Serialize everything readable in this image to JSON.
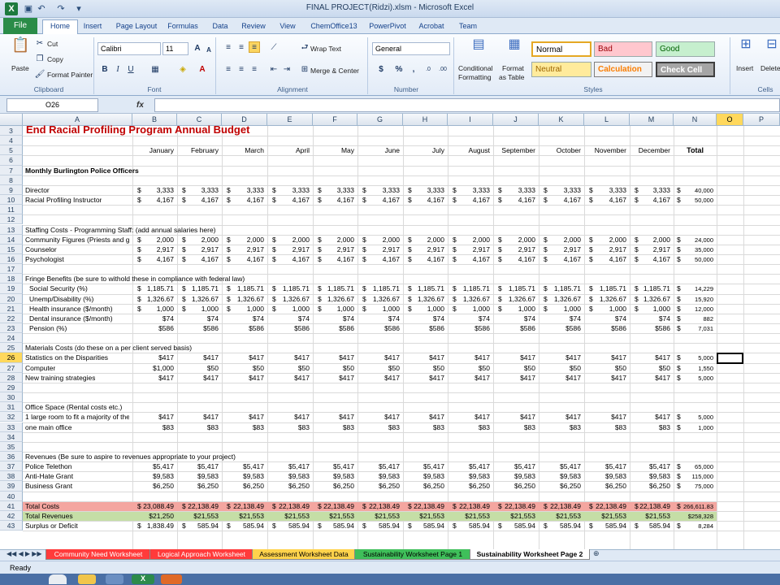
{
  "window": {
    "title": "FINAL PROJECT(Ridzi).xlsm  -  Microsoft Excel"
  },
  "ribbon": {
    "tabs": [
      "File",
      "Home",
      "Insert",
      "Page Layout",
      "Formulas",
      "Data",
      "Review",
      "View",
      "ChemOffice13",
      "PowerPivot",
      "Acrobat",
      "Team"
    ],
    "clipboard": {
      "paste": "Paste",
      "cut": "Cut",
      "copy": "Copy",
      "format_painter": "Format Painter",
      "label": "Clipboard"
    },
    "font": {
      "name": "Calibri",
      "size": "11",
      "label": "Font"
    },
    "alignment": {
      "wrap": "Wrap Text",
      "merge": "Merge & Center",
      "label": "Alignment"
    },
    "number": {
      "format": "General",
      "label": "Number"
    },
    "styles": {
      "cond": "Conditional",
      "cond2": "Formatting",
      "fmt": "Format",
      "fmt2": "as Table",
      "normal": "Normal",
      "bad": "Bad",
      "good": "Good",
      "neutral": "Neutral",
      "calculation": "Calculation",
      "check": "Check Cell",
      "label": "Styles"
    },
    "cells": {
      "insert": "Insert",
      "delete": "Delete",
      "label": "Cells"
    }
  },
  "formula_bar": {
    "name_box": "O26",
    "fx": "fx"
  },
  "grid": {
    "columns": [
      "A",
      "B",
      "C",
      "D",
      "E",
      "F",
      "G",
      "H",
      "I",
      "J",
      "K",
      "L",
      "M",
      "N",
      "O",
      "P"
    ],
    "month_headers": [
      "January",
      "February",
      "March",
      "April",
      "May",
      "June",
      "July",
      "August",
      "September",
      "October",
      "November",
      "December",
      "Total"
    ],
    "title": "End Racial Profiling Program Annual Budget",
    "rows": [
      {
        "n": "3",
        "label": "End Racial Profiling Program Annual Budget",
        "type": "title"
      },
      {
        "n": "4"
      },
      {
        "n": "5",
        "type": "months"
      },
      {
        "n": "6"
      },
      {
        "n": "7",
        "label": "Monthly Burlington Police Officers",
        "type": "bold"
      },
      {
        "n": "8"
      },
      {
        "n": "9",
        "label": "Director",
        "vals": [
          "3,333",
          "3,333",
          "3,333",
          "3,333",
          "3,333",
          "3,333",
          "3,333",
          "3,333",
          "3,333",
          "3,333",
          "3,333",
          "3,333"
        ],
        "total": "40,000",
        "dollar": true
      },
      {
        "n": "10",
        "label": "Racial Profiling Instructor",
        "vals": [
          "4,167",
          "4,167",
          "4,167",
          "4,167",
          "4,167",
          "4,167",
          "4,167",
          "4,167",
          "4,167",
          "4,167",
          "4,167",
          "4,167"
        ],
        "total": "50,000",
        "dollar": true
      },
      {
        "n": "11"
      },
      {
        "n": "12"
      },
      {
        "n": "13",
        "label": "Staffing Costs - Programming Staff: (add annual salaries here)"
      },
      {
        "n": "14",
        "label": "Community Figures (Priests and group lea",
        "vals": [
          "2,000",
          "2,000",
          "2,000",
          "2,000",
          "2,000",
          "2,000",
          "2,000",
          "2,000",
          "2,000",
          "2,000",
          "2,000",
          "2,000"
        ],
        "total": "24,000",
        "dollar": true
      },
      {
        "n": "15",
        "label": "Counselor",
        "vals": [
          "2,917",
          "2,917",
          "2,917",
          "2,917",
          "2,917",
          "2,917",
          "2,917",
          "2,917",
          "2,917",
          "2,917",
          "2,917",
          "2,917"
        ],
        "total": "35,000",
        "dollar": true
      },
      {
        "n": "16",
        "label": "Psychologist",
        "vals": [
          "4,167",
          "4,167",
          "4,167",
          "4,167",
          "4,167",
          "4,167",
          "4,167",
          "4,167",
          "4,167",
          "4,167",
          "4,167",
          "4,167"
        ],
        "total": "50,000",
        "dollar": true
      },
      {
        "n": "17"
      },
      {
        "n": "18",
        "label": "Fringe Benefits (be sure to withold these in compliance with federal law)"
      },
      {
        "n": "19",
        "label": "Social Security (%)",
        "vals": [
          "1,185.71",
          "1,185.71",
          "1,185.71",
          "1,185.71",
          "1,185.71",
          "1,185.71",
          "1,185.71",
          "1,185.71",
          "1,185.71",
          "1,185.71",
          "1,185.71",
          "1,185.71"
        ],
        "total": "14,229",
        "dollar": true,
        "indent": true
      },
      {
        "n": "20",
        "label": "Unemp/Disability (%)",
        "vals": [
          "1,326.67",
          "1,326.67",
          "1,326.67",
          "1,326.67",
          "1,326.67",
          "1,326.67",
          "1,326.67",
          "1,326.67",
          "1,326.67",
          "1,326.67",
          "1,326.67",
          "1,326.67"
        ],
        "total": "15,920",
        "dollar": true,
        "indent": true
      },
      {
        "n": "21",
        "label": "Health insurance ($/month)",
        "vals": [
          "1,000",
          "1,000",
          "1,000",
          "1,000",
          "1,000",
          "1,000",
          "1,000",
          "1,000",
          "1,000",
          "1,000",
          "1,000",
          "1,000"
        ],
        "total": "12,000",
        "dollar": true,
        "indent": true
      },
      {
        "n": "22",
        "label": "Dental insurance ($/month)",
        "vals": [
          "$74",
          "$74",
          "$74",
          "$74",
          "$74",
          "$74",
          "$74",
          "$74",
          "$74",
          "$74",
          "$74",
          "$74"
        ],
        "total": "882",
        "indent": true,
        "tdollar": true
      },
      {
        "n": "23",
        "label": "Pension (%)",
        "vals": [
          "$586",
          "$586",
          "$586",
          "$586",
          "$586",
          "$586",
          "$586",
          "$586",
          "$586",
          "$586",
          "$586",
          "$586"
        ],
        "total": "7,031",
        "indent": true,
        "tdollar": true
      },
      {
        "n": "24"
      },
      {
        "n": "25",
        "label": "Materials Costs (do these on a per client served basis)"
      },
      {
        "n": "26",
        "label": "Statistics on the Disparities",
        "vals": [
          "$417",
          "$417",
          "$417",
          "$417",
          "$417",
          "$417",
          "$417",
          "$417",
          "$417",
          "$417",
          "$417",
          "$417"
        ],
        "total": "5,000",
        "tdollar": true
      },
      {
        "n": "27",
        "label": "Computer",
        "vals": [
          "$1,000",
          "$50",
          "$50",
          "$50",
          "$50",
          "$50",
          "$50",
          "$50",
          "$50",
          "$50",
          "$50",
          "$50"
        ],
        "total": "1,550",
        "tdollar": true
      },
      {
        "n": "28",
        "label": "New training strategies",
        "vals": [
          "$417",
          "$417",
          "$417",
          "$417",
          "$417",
          "$417",
          "$417",
          "$417",
          "$417",
          "$417",
          "$417",
          "$417"
        ],
        "total": "5,000",
        "tdollar": true
      },
      {
        "n": "29"
      },
      {
        "n": "30"
      },
      {
        "n": "31",
        "label": "Office Space (Rental costs etc.)"
      },
      {
        "n": "32",
        "label": "1 large room to fit a majority of the Police fo",
        "vals": [
          "$417",
          "$417",
          "$417",
          "$417",
          "$417",
          "$417",
          "$417",
          "$417",
          "$417",
          "$417",
          "$417",
          "$417"
        ],
        "total": "5,000",
        "tdollar": true
      },
      {
        "n": "33",
        "label": "one main office",
        "vals": [
          "$83",
          "$83",
          "$83",
          "$83",
          "$83",
          "$83",
          "$83",
          "$83",
          "$83",
          "$83",
          "$83",
          "$83"
        ],
        "total": "1,000",
        "tdollar": true
      },
      {
        "n": "34"
      },
      {
        "n": "35"
      },
      {
        "n": "36",
        "label": "Revenues (Be sure to aspire to revenues appropriate to your project)"
      },
      {
        "n": "37",
        "label": "Police Telethon",
        "vals": [
          "$5,417",
          "$5,417",
          "$5,417",
          "$5,417",
          "$5,417",
          "$5,417",
          "$5,417",
          "$5,417",
          "$5,417",
          "$5,417",
          "$5,417",
          "$5,417"
        ],
        "total": "65,000",
        "tdollar": true
      },
      {
        "n": "38",
        "label": "Anti-Hate Grant",
        "vals": [
          "$9,583",
          "$9,583",
          "$9,583",
          "$9,583",
          "$9,583",
          "$9,583",
          "$9,583",
          "$9,583",
          "$9,583",
          "$9,583",
          "$9,583",
          "$9,583"
        ],
        "total": "115,000",
        "tdollar": true
      },
      {
        "n": "39",
        "label": "Business Grant",
        "vals": [
          "$6,250",
          "$6,250",
          "$6,250",
          "$6,250",
          "$6,250",
          "$6,250",
          "$6,250",
          "$6,250",
          "$6,250",
          "$6,250",
          "$6,250",
          "$6,250"
        ],
        "total": "75,000",
        "tdollar": true
      },
      {
        "n": "40"
      },
      {
        "n": "41",
        "label": "Total Costs",
        "vals": [
          "23,088.49",
          "22,138.49",
          "22,138.49",
          "22,138.49",
          "22,138.49",
          "22,138.49",
          "22,138.49",
          "22,138.49",
          "22,138.49",
          "22,138.49",
          "22,138.49",
          "22,138.49"
        ],
        "total": "266,611.83",
        "dollar": true,
        "fill": "#f4a6a0"
      },
      {
        "n": "42",
        "label": "Total Revenues",
        "vals": [
          "$21,250",
          "$21,553",
          "$21,553",
          "$21,553",
          "$21,553",
          "$21,553",
          "$21,553",
          "$21,553",
          "$21,553",
          "$21,553",
          "$21,553",
          "$21,553"
        ],
        "total": "$258,328",
        "fill": "#c5dea6"
      },
      {
        "n": "43",
        "label": "Surplus or Deficit",
        "vals": [
          "1,838.49",
          "585.94",
          "585.94",
          "585.94",
          "585.94",
          "585.94",
          "585.94",
          "585.94",
          "585.94",
          "585.94",
          "585.94",
          "585.94"
        ],
        "total": "8,284",
        "dollar": true
      }
    ]
  },
  "sheets": [
    "Community Need Worksheet",
    "Logical Approach Worksheet",
    "Assessment Worksheet Data",
    "Sustainability Worksheet Page 1",
    "Sustainability Worksheet Page 2"
  ],
  "status": "Ready",
  "colors": {
    "accent": "#1d7a3e",
    "total_costs": "#f4a6a0",
    "total_revenues": "#c5dea6",
    "title_red": "#c00000"
  }
}
